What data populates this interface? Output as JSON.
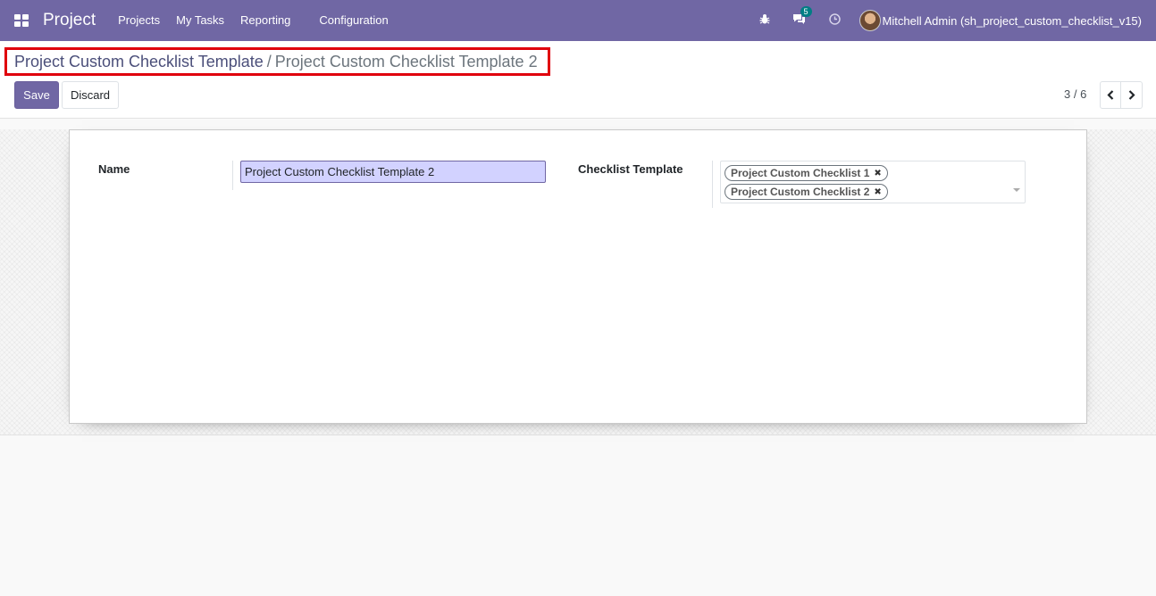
{
  "navbar": {
    "brand": "Project",
    "menu": [
      "Projects",
      "My Tasks",
      "Reporting",
      "Configuration"
    ],
    "messages_count": "5",
    "user_name": "Mitchell Admin (sh_project_custom_checklist_v15)",
    "icons": [
      "apps-icon",
      "bug-icon",
      "chat-icon",
      "clock-icon"
    ]
  },
  "breadcrumb": {
    "parent": "Project Custom Checklist Template",
    "separator": "/",
    "current": "Project Custom Checklist Template 2"
  },
  "buttons": {
    "save": "Save",
    "discard": "Discard"
  },
  "pager": {
    "value": "3 / 6"
  },
  "form": {
    "name_label": "Name",
    "name_value": "Project Custom Checklist Template 2",
    "checklist_label": "Checklist Template",
    "checklist_tags": [
      "Project Custom Checklist 1",
      "Project Custom Checklist 2"
    ]
  },
  "colors": {
    "navbar": "#7067a4",
    "highlight_border": "#e0000c",
    "badge": "#017e84",
    "input_focus": "#d2d2ff"
  }
}
